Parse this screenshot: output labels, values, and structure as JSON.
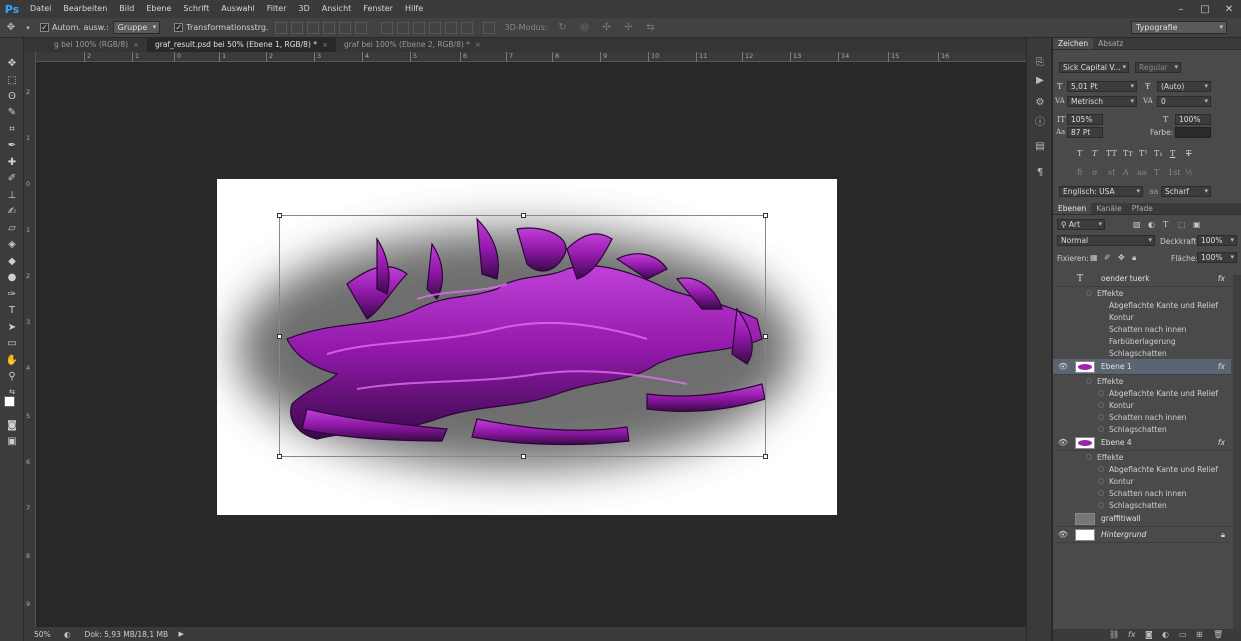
{
  "app": {
    "logo": "Ps",
    "menu": [
      "Datei",
      "Bearbeiten",
      "Bild",
      "Ebene",
      "Schrift",
      "Auswahl",
      "Filter",
      "3D",
      "Ansicht",
      "Fenster",
      "Hilfe"
    ],
    "window_controls": [
      "–",
      "□",
      "✕"
    ]
  },
  "options": {
    "auto_select_label": "Autom. ausw.:",
    "auto_select_value": "Gruppe",
    "transform_label": "Transformationsstrg.",
    "mode3d_label": "3D-Modus:",
    "workspace": "Typografie"
  },
  "tabs": [
    {
      "label": "g bei 100% (RGB/8)",
      "active": false
    },
    {
      "label": "graf_result.psd bei 50% (Ebene 1, RGB/8) *",
      "active": true
    },
    {
      "label": "graf bei 100% (Ebene 2, RGB/8) *",
      "active": false
    }
  ],
  "ruler": {
    "h_ticks": [
      "2",
      "1",
      "0",
      "1",
      "2",
      "3",
      "4",
      "5",
      "6",
      "7",
      "8",
      "9",
      "10",
      "11",
      "12",
      "13",
      "14",
      "15",
      "16"
    ],
    "v_ticks": [
      "2",
      "1",
      "0",
      "1",
      "2",
      "3",
      "4",
      "5",
      "6",
      "7",
      "8",
      "9"
    ]
  },
  "status": {
    "zoom": "50%",
    "doc_info": "Dok: 5,93 MB/18,1 MB"
  },
  "character": {
    "tabs": [
      "Zeichen",
      "Absatz"
    ],
    "font_family": "Sick Capital V...",
    "font_style": "Regular",
    "font_size": "5,01 Pt",
    "leading": "(Auto)",
    "kerning": "Metrisch",
    "tracking": "0",
    "vertical_scale": "105%",
    "horizontal_scale": "100%",
    "baseline": "87 Pt",
    "color_label": "Farbe:",
    "language": "Englisch: USA",
    "aa_label": "aa",
    "antialias": "Scharf"
  },
  "layers": {
    "tabs": [
      "Ebenen",
      "Kanäle",
      "Pfade"
    ],
    "filter_kind": "Art",
    "blend_mode": "Normal",
    "opacity_label": "Deckkraft:",
    "opacity": "100%",
    "lock_label": "Fixieren:",
    "fill_label": "Fläche:",
    "fill": "100%",
    "effects_label": "Effekte",
    "fx_label": "fx",
    "items": [
      {
        "name": "oender tuerk",
        "type": "text",
        "visible": false,
        "effects": [
          "Abgeflachte Kante und Relief",
          "Kontur",
          "Schatten nach innen",
          "Farbüberlagerung",
          "Schlagschatten"
        ]
      },
      {
        "name": "Ebene 1",
        "type": "image",
        "visible": true,
        "selected": true,
        "effects": [
          "Abgeflachte Kante und Relief",
          "Kontur",
          "Schatten nach innen",
          "Schlagschatten"
        ]
      },
      {
        "name": "Ebene 4",
        "type": "image",
        "visible": true,
        "effects": [
          "Abgeflachte Kante und Relief",
          "Kontur",
          "Schatten nach innen",
          "Schlagschatten"
        ]
      },
      {
        "name": "graffitiwall",
        "type": "image",
        "visible": false,
        "effects": []
      },
      {
        "name": "Hintergrund",
        "type": "background",
        "visible": true,
        "effects": []
      }
    ]
  },
  "colors": {
    "graffiti_primary": "#a020b0",
    "graffiti_dark": "#3a0a4a",
    "selected_layer": "#5b6472"
  }
}
